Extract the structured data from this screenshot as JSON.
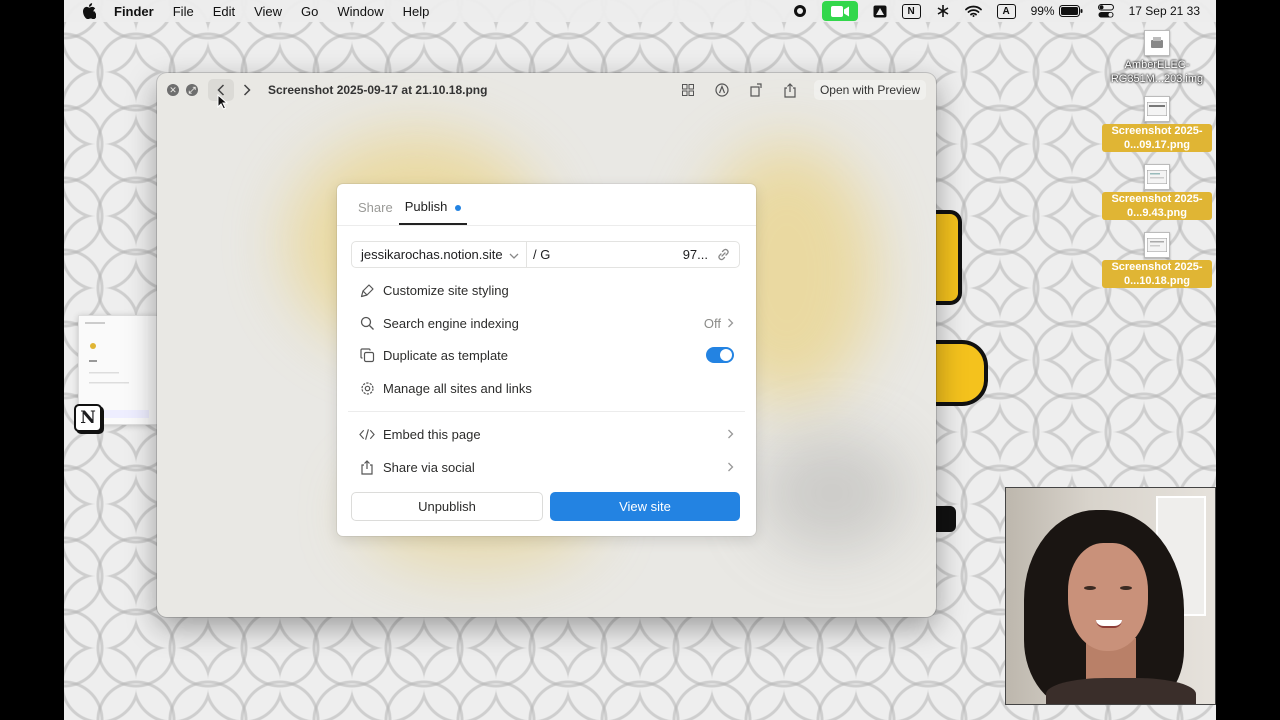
{
  "menubar": {
    "app_name": "Finder",
    "menus": [
      "File",
      "Edit",
      "View",
      "Go",
      "Window",
      "Help"
    ],
    "battery": "99%",
    "keyboard_input": "A",
    "notion_letter": "N",
    "datetime": "17 Sep  21 33",
    "accent_colors": {
      "facetime": "#32d74b"
    }
  },
  "desktop": {
    "items": [
      {
        "label": "AmberELEC-RG351M...203.img",
        "selected": false
      },
      {
        "label": "Screenshot 2025-0...09.17.png",
        "selected": true
      },
      {
        "label": "Screenshot 2025-0...9.43.png",
        "selected": true
      },
      {
        "label": "Screenshot 2025-0...10.18.png",
        "selected": true
      }
    ],
    "selection_color": "#e0b534",
    "dock_notion_letter": "N"
  },
  "quicklook": {
    "title": "Screenshot 2025-09-17 at 21.10.18.png",
    "open_with": "Open with Preview",
    "tools": [
      "grid-icon",
      "markup-icon",
      "rotate-icon",
      "share-icon"
    ]
  },
  "publish_panel": {
    "tabs": [
      {
        "label": "Share",
        "active": false
      },
      {
        "label": "Publish",
        "active": true
      }
    ],
    "url": {
      "domain": "jessikarochas.notion.site",
      "slug": "/ G",
      "suffix": "97..."
    },
    "options": [
      {
        "label": "Customize site styling",
        "icon": "brush-icon"
      },
      {
        "label": "Search engine indexing",
        "icon": "search-icon",
        "value": "Off"
      },
      {
        "label": "Duplicate as template",
        "icon": "duplicate-icon",
        "toggle": true
      },
      {
        "label": "Manage all sites and links",
        "icon": "gear-icon"
      }
    ],
    "links": [
      {
        "label": "Embed this page",
        "icon": "code-icon"
      },
      {
        "label": "Share via social",
        "icon": "share-icon"
      }
    ],
    "unpublish_label": "Unpublish",
    "view_site_label": "View site",
    "accent": "#2383e2"
  }
}
